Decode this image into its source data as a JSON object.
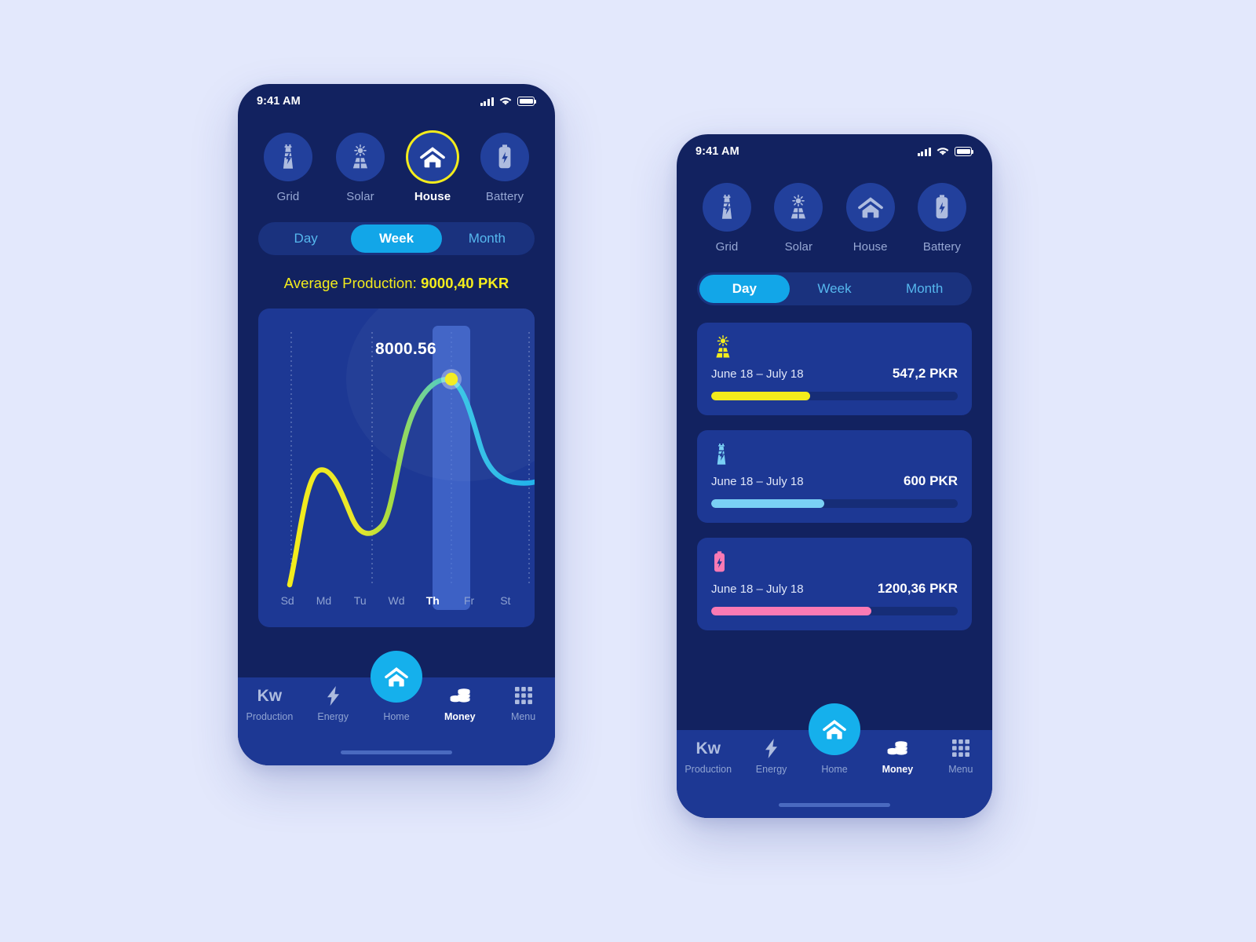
{
  "page": {
    "background_color": "#e3e8fc",
    "phone_background": "#122260",
    "card_background": "#1d3894"
  },
  "colors": {
    "accent_cyan": "#12a6e8",
    "accent_yellow": "#f3ec1c",
    "accent_pink": "#fa7ab4",
    "accent_light_blue": "#7ad0f5",
    "muted_text": "#8fa3d2"
  },
  "status_bar": {
    "time": "9:41 AM",
    "icons": [
      "signal-icon",
      "wifi-icon",
      "battery-icon"
    ]
  },
  "sources": [
    {
      "id": "grid",
      "label": "Grid",
      "icon": "power-tower-icon",
      "selected": false
    },
    {
      "id": "solar",
      "label": "Solar",
      "icon": "solar-panel-icon",
      "selected": false
    },
    {
      "id": "house",
      "label": "House",
      "icon": "house-icon",
      "selected": true
    },
    {
      "id": "battery",
      "label": "Battery",
      "icon": "battery-bolt-icon",
      "selected": false
    }
  ],
  "sources_right": [
    {
      "id": "grid",
      "label": "Grid",
      "icon": "power-tower-icon",
      "selected": false
    },
    {
      "id": "solar",
      "label": "Solar",
      "icon": "solar-panel-icon",
      "selected": false
    },
    {
      "id": "house",
      "label": "House",
      "icon": "house-icon",
      "selected": false
    },
    {
      "id": "battery",
      "label": "Battery",
      "icon": "battery-bolt-icon",
      "selected": false
    }
  ],
  "left_screen": {
    "period_tabs": [
      {
        "label": "Day",
        "selected": false
      },
      {
        "label": "Week",
        "selected": true
      },
      {
        "label": "Month",
        "selected": false
      }
    ],
    "average_label": "Average Production:",
    "average_value": "9000,40 PKR",
    "tooltip_value": "8000.56"
  },
  "right_screen": {
    "period_tabs": [
      {
        "label": "Day",
        "selected": true
      },
      {
        "label": "Week",
        "selected": false
      },
      {
        "label": "Month",
        "selected": false
      }
    ],
    "cards": [
      {
        "icon": "solar-panel-icon",
        "range": "June 18 – July 18",
        "amount": "547,2 PKR",
        "progress": 40,
        "color": "#f3ec1c"
      },
      {
        "icon": "power-tower-icon",
        "range": "June 18 – July 18",
        "amount": "600 PKR",
        "progress": 46,
        "color": "#7ad0f5"
      },
      {
        "icon": "battery-bolt-icon",
        "range": "June 18 – July 18",
        "amount": "1200,36 PKR",
        "progress": 65,
        "color": "#fa7ab4"
      }
    ]
  },
  "bottom_nav": [
    {
      "id": "production",
      "label": "Production",
      "icon": "kw-icon",
      "active": false
    },
    {
      "id": "energy",
      "label": "Energy",
      "icon": "bolt-icon",
      "active": false
    },
    {
      "id": "home",
      "label": "Home",
      "icon": "house-icon",
      "active": false
    },
    {
      "id": "money",
      "label": "Money",
      "icon": "coins-icon",
      "active": true
    },
    {
      "id": "menu",
      "label": "Menu",
      "icon": "grid-menu-icon",
      "active": false
    }
  ],
  "nav_kw_text": "Kw",
  "chart_data": {
    "type": "line",
    "title": "",
    "xlabel": "",
    "ylabel": "",
    "categories": [
      "Sd",
      "Md",
      "Tu",
      "Wd",
      "Th",
      "Fr",
      "St"
    ],
    "values": [
      400,
      3700,
      2400,
      2600,
      8000.56,
      6400,
      4300
    ],
    "highlighted_category": "Th",
    "highlighted_value": "8000.56",
    "gridlines": "vertical-dotted",
    "legend": "none",
    "line_gradient": [
      "#f3ec1c",
      "#8fd94f",
      "#38c8ef",
      "#23b4ea"
    ],
    "marker_color": "#f3ec1c"
  }
}
